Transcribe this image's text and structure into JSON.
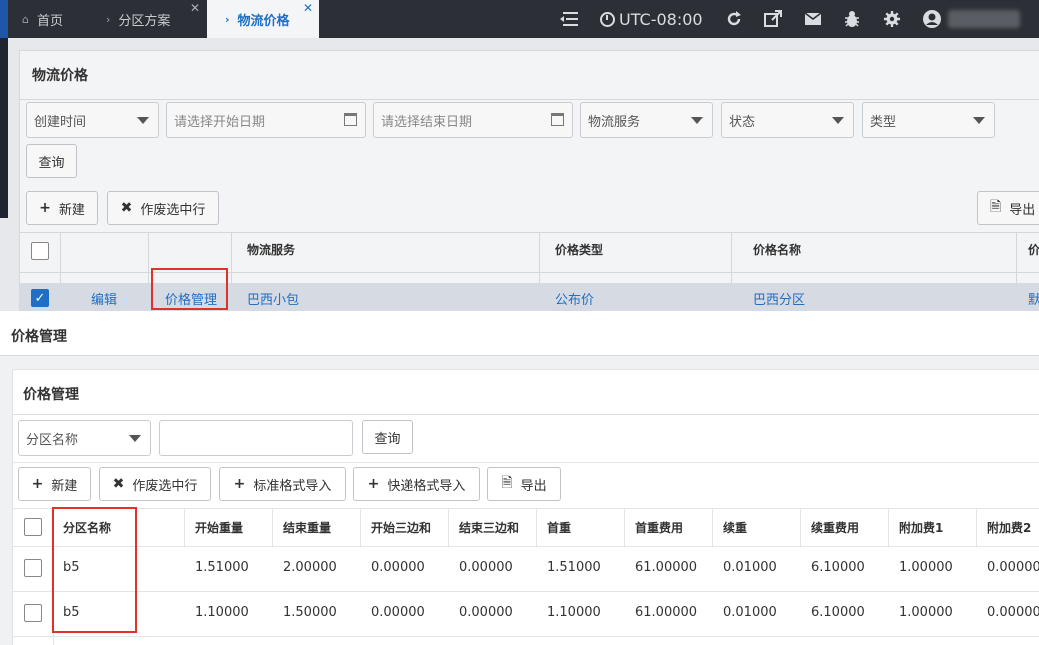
{
  "topbar": {
    "tabs": [
      {
        "label": "首页",
        "icon": "home-icon"
      },
      {
        "label": "分区方案",
        "icon": "chevron-right-icon"
      },
      {
        "label": "物流价格",
        "icon": "chevron-right-icon"
      }
    ],
    "timezone": "UTC-08:00"
  },
  "page": {
    "title": "物流价格",
    "filters": {
      "time_type": "创建时间",
      "start_date_placeholder": "请选择开始日期",
      "end_date_placeholder": "请选择结束日期",
      "service": "物流服务",
      "status": "状态",
      "type": "类型",
      "query_label": "查询"
    },
    "toolbar": {
      "new_label": "新建",
      "void_label": "作废选中行",
      "export_label": "导出"
    },
    "table": {
      "headers": [
        "物流服务",
        "价格类型",
        "价格名称",
        "价"
      ],
      "row": {
        "edit": "编辑",
        "price_manage": "价格管理",
        "service": "巴西小包",
        "price_type": "公布价",
        "price_name": "巴西分区",
        "extra": "默"
      }
    }
  },
  "modal": {
    "title": "价格管理",
    "inner_title": "价格管理",
    "filter": {
      "field": "分区名称",
      "query_label": "查询"
    },
    "toolbar": {
      "new_label": "新建",
      "void_label": "作废选中行",
      "std_import_label": "标准格式导入",
      "express_import_label": "快递格式导入",
      "export_label": "导出"
    },
    "table": {
      "headers": [
        "分区名称",
        "开始重量",
        "结束重量",
        "开始三边和",
        "结束三边和",
        "首重",
        "首重费用",
        "续重",
        "续重费用",
        "附加费1",
        "附加费2"
      ],
      "rows": [
        [
          "b5",
          "1.51000",
          "2.00000",
          "0.00000",
          "0.00000",
          "1.51000",
          "61.00000",
          "0.01000",
          "6.10000",
          "1.00000",
          "0.00000"
        ],
        [
          "b5",
          "1.10000",
          "1.50000",
          "0.00000",
          "0.00000",
          "1.10000",
          "61.00000",
          "0.01000",
          "6.10000",
          "1.00000",
          "0.00000"
        ]
      ]
    }
  },
  "colors": {
    "topbar": "#2c3036",
    "accent": "#1f6fc4",
    "highlight": "#e0312a"
  }
}
